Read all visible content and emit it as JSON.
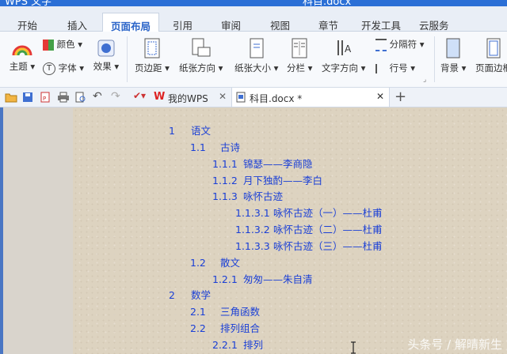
{
  "window": {
    "app_title": "WPS 文字",
    "doc_title": "科目.docx"
  },
  "menu_tabs": [
    "开始",
    "插入",
    "页面布局",
    "引用",
    "审阅",
    "视图",
    "章节",
    "开发工具",
    "云服务"
  ],
  "active_menu_tab": "页面布局",
  "ribbon": {
    "theme": "主题",
    "color": "颜色",
    "font": "字体",
    "effect": "效果",
    "margins": "页边距",
    "orientation": "纸张方向",
    "size": "纸张大小",
    "columns": "分栏",
    "text_direction": "文字方向",
    "breaks": "分隔符",
    "line_numbers": "行号",
    "background": "背景",
    "page_border": "页面边框"
  },
  "doc_tabs": [
    {
      "label": "我的WPS",
      "icon": "wps-logo-icon",
      "active": false
    },
    {
      "label": "科目.docx *",
      "icon": "document-icon",
      "active": true
    }
  ],
  "toc": [
    {
      "num": "1",
      "text": "语文",
      "level": 1
    },
    {
      "num": "1.1",
      "text": "古诗",
      "level": 2
    },
    {
      "num": "1.1.1",
      "text": "锦瑟——李商隐",
      "level": 3
    },
    {
      "num": "1.1.2",
      "text": "月下独酌——李白",
      "level": 3
    },
    {
      "num": "1.1.3",
      "text": "咏怀古迹",
      "level": 3
    },
    {
      "num": "1.1.3.1",
      "text": "咏怀古迹（一）——杜甫",
      "level": 4
    },
    {
      "num": "1.1.3.2",
      "text": "咏怀古迹（二）——杜甫",
      "level": 4
    },
    {
      "num": "1.1.3.3",
      "text": "咏怀古迹（三）——杜甫",
      "level": 4
    },
    {
      "num": "1.2",
      "text": "散文",
      "level": 2
    },
    {
      "num": "1.2.1",
      "text": "匆匆——朱自清",
      "level": 3
    },
    {
      "num": "2",
      "text": "数学",
      "level": 1
    },
    {
      "num": "2.1",
      "text": "三角函数",
      "level": 2
    },
    {
      "num": "2.2",
      "text": "排列组合",
      "level": 2
    },
    {
      "num": "2.2.1",
      "text": "排列",
      "level": 3
    }
  ],
  "watermark": "头条号 / 解晴新生",
  "colors": {
    "accent": "#2a64c8",
    "toc_text": "#1a3fd6",
    "page_bg": "#ddd3c0",
    "title_bar": "#2b6fd6"
  }
}
